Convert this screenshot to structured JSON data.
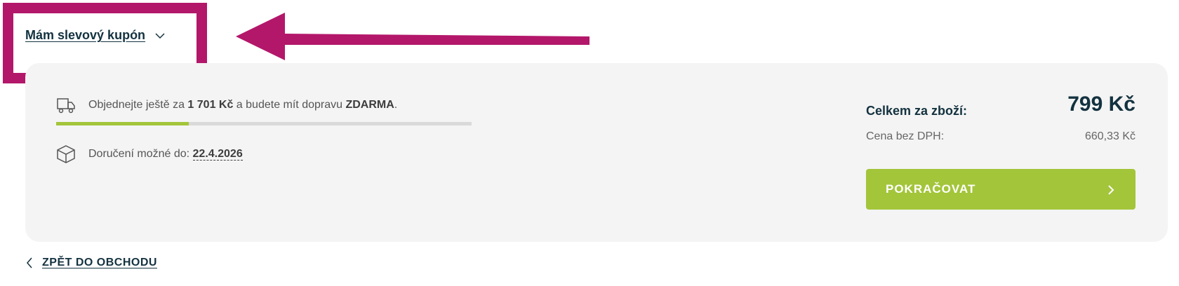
{
  "coupon": {
    "label": "Mám slevový kupón",
    "icon": "chevron-down-icon"
  },
  "annotation": {
    "color": "#b3176a"
  },
  "shipping": {
    "prefix": "Objednejte ještě za ",
    "amount": "1 701 Kč",
    "middle": " a budete mít dopravu ",
    "free": "ZDARMA",
    "suffix": ".",
    "progress": 0.32,
    "icon": "truck-icon"
  },
  "delivery": {
    "label": "Doručení možné do: ",
    "date": "22.4.2026",
    "icon": "box-icon"
  },
  "totals": {
    "total_label": "Celkem za zboží:",
    "total_value": "799 Kč",
    "net_label": "Cena bez DPH:",
    "net_value": "660,33 Kč"
  },
  "actions": {
    "continue_label": "POKRAČOVAT",
    "back_label": "ZPĚT DO OBCHODU"
  },
  "colors": {
    "accent": "#a3c53a",
    "heading": "#13323f",
    "panel": "#f4f4f4"
  }
}
